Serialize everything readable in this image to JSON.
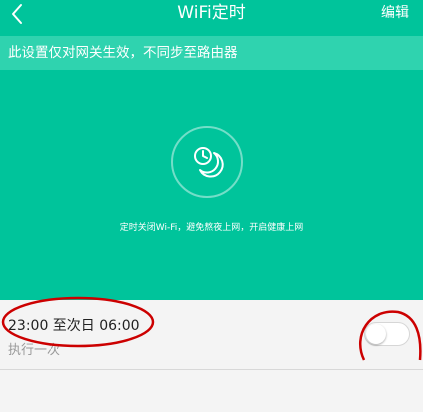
{
  "header": {
    "title": "WiFi定时",
    "edit_label": "编辑",
    "back_icon": "chevron-left-icon"
  },
  "notice": {
    "text": "此设置仅对网关生效，不同步至路由器"
  },
  "hero": {
    "icon": "clock-moon-icon",
    "caption": "定时关闭Wi-Fi，避免熬夜上网，开启健康上网"
  },
  "schedule": {
    "items": [
      {
        "time_range": "23:00 至次日 06:00",
        "repeat": "执行一次",
        "enabled": false
      }
    ]
  },
  "colors": {
    "primary": "#00c49b",
    "notice_bg": "#2fd3af",
    "annotation": "#cc0000",
    "page_bg": "#f4f4f4"
  }
}
